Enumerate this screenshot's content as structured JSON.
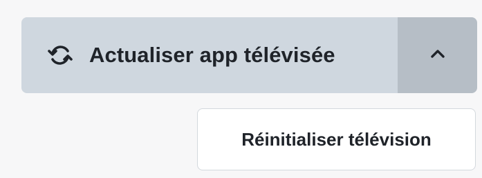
{
  "split_button": {
    "main_label": "Actualiser app télévisée",
    "main_icon": "refresh-icon",
    "toggle_icon": "chevron-up-icon",
    "colors": {
      "main_bg": "#cfd7df",
      "toggle_bg": "#b6bec6",
      "text": "#1f2329"
    }
  },
  "dropdown": {
    "items": [
      {
        "label": "Réinitialiser télévision"
      }
    ]
  }
}
